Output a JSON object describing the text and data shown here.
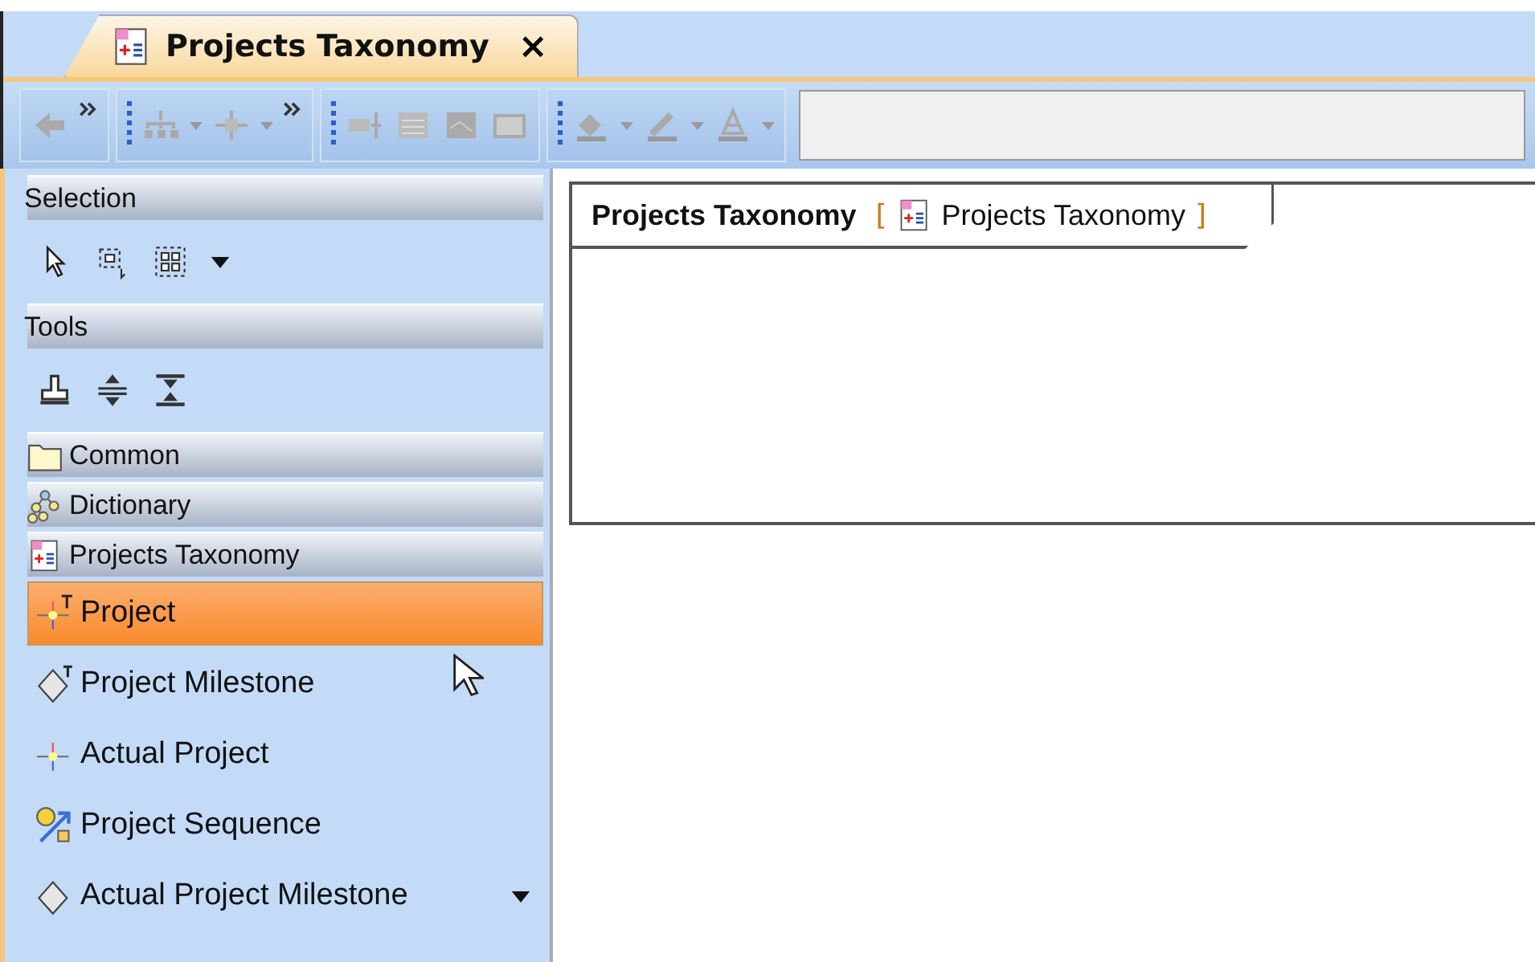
{
  "tab": {
    "title": "Projects Taxonomy",
    "close": "×",
    "selected": true
  },
  "palette": {
    "sections": [
      {
        "kind": "tools",
        "title": "Selection"
      },
      {
        "kind": "tools",
        "title": "Tools"
      },
      {
        "kind": "category",
        "title": "Common"
      },
      {
        "kind": "category",
        "title": "Dictionary"
      },
      {
        "kind": "list",
        "title": "Projects Taxonomy",
        "items": [
          {
            "label": "Project",
            "selected": true
          },
          {
            "label": "Project Milestone",
            "selected": false
          },
          {
            "label": "Actual Project",
            "selected": false
          },
          {
            "label": "Project Sequence",
            "selected": false
          },
          {
            "label": "Actual Project Milestone",
            "selected": false
          }
        ]
      }
    ]
  },
  "diagram": {
    "frame": {
      "name": "Projects Taxonomy",
      "open_bracket": "[",
      "type_label": "Projects Taxonomy",
      "close_bracket": "]"
    }
  }
}
